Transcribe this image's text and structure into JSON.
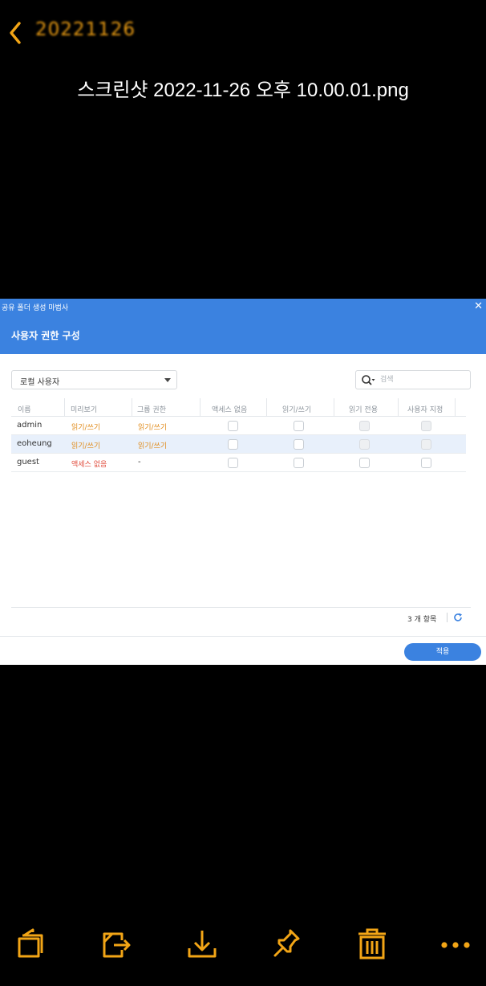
{
  "header": {
    "back_label": "20221126",
    "file_title": "스크린샷 2022-11-26 오후 10.00.01.png"
  },
  "dialog": {
    "wizard_title": "공유 폴더 생성 마법사",
    "close_symbol": "✕",
    "section_title": "사용자 권한 구성",
    "user_type": "로컬 사용자",
    "search_placeholder": "검색",
    "columns": [
      "이름",
      "미리보기",
      "그룹 권한",
      "액세스 없음",
      "읽기/쓰기",
      "읽기 전용",
      "사용자 지정"
    ],
    "rows": [
      {
        "name": "admin",
        "preview": "읽기/쓰기",
        "group": "읽기/쓰기",
        "disabled_cols": [
          5,
          6
        ]
      },
      {
        "name": "eoheung",
        "preview": "읽기/쓰기",
        "group": "읽기/쓰기",
        "disabled_cols": [
          5,
          6
        ]
      },
      {
        "name": "guest",
        "preview": "액세스 없음",
        "group": "-",
        "disabled_cols": []
      }
    ],
    "item_count": "3 개 항목",
    "apply_label": "적용"
  },
  "colors": {
    "accent": "#3b82e0",
    "toolbar_icon": "#f2a516",
    "perm_rw": "#e08a18",
    "perm_none": "#e04a3a"
  },
  "toolbar": {
    "icons": [
      "copy-icon",
      "move-icon",
      "download-icon",
      "pin-icon",
      "trash-icon",
      "more-icon"
    ]
  }
}
